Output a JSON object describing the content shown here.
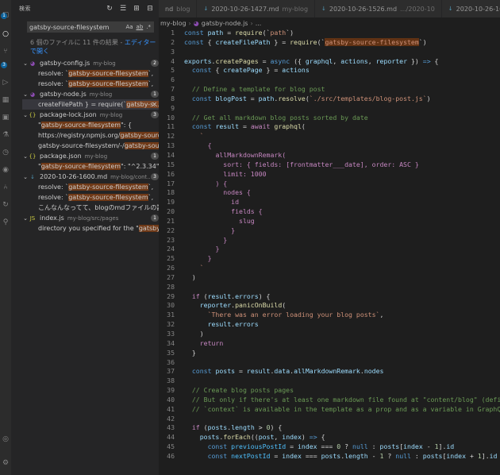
{
  "activity_bar": {
    "icons": [
      "files-icon",
      "search-icon",
      "source-control-icon",
      "debug-icon",
      "extensions-icon",
      "remote-icon",
      "test-icon",
      "timeline-icon",
      "github-icon",
      "account-icon",
      "settings-icon"
    ],
    "badges": {
      "files": "1",
      "scm": "3"
    }
  },
  "sidebar": {
    "title": "検索",
    "search_value": "gatsby-source-filesystem",
    "case_label": "Aa",
    "word_label": "ab",
    "regex_label": ".*",
    "summary_prefix": "6 個のファイルに 11 件の結果 - ",
    "summary_link": "エディターで開く",
    "results": [
      {
        "name": "gatsby-config.js",
        "path": "my-blog",
        "count": "2",
        "icon": "gatsby-icon",
        "matches": [
          {
            "pre": "resolve: `",
            "hit": "gatsby-source-filesystem",
            "post": "`,"
          },
          {
            "pre": "resolve: `",
            "hit": "gatsby-source-filesystem",
            "post": "`,"
          }
        ]
      },
      {
        "name": "gatsby-node.js",
        "path": "my-blog",
        "count": "1",
        "icon": "gatsby-icon",
        "matches": [
          {
            "pre": "createFilePath } = require(`",
            "hit": "gatsby-s...",
            "post": "",
            "selected": true
          }
        ]
      },
      {
        "name": "package-lock.json",
        "path": "my-blog",
        "count": "3",
        "icon": "json-icon",
        "matches": [
          {
            "pre": "\"",
            "hit": "gatsby-source-filesystem",
            "post": "\": {"
          },
          {
            "pre": "https://registry.npmjs.org/",
            "hit": "gatsby-source-fi...",
            "post": ""
          },
          {
            "pre": "gatsby-source-filesystem/-/",
            "hit": "gatsby-source...",
            "post": ""
          }
        ]
      },
      {
        "name": "package.json",
        "path": "my-blog",
        "count": "1",
        "icon": "json-icon",
        "matches": [
          {
            "pre": "\"",
            "hit": "gatsby-source-filesystem",
            "post": "\": \"^2.3.34\","
          }
        ]
      },
      {
        "name": "2020-10-26-1600.md",
        "path": "my-blog/cont...",
        "count": "3",
        "icon": "markdown-icon",
        "matches": [
          {
            "pre": "resolve: `",
            "hit": "gatsby-source-filesystem",
            "post": "`,"
          },
          {
            "pre": "resolve: `",
            "hit": "gatsby-source-filesystem",
            "post": "`,"
          },
          {
            "pre": "こんなんなってて、blogのmdファイルの読...",
            "hit": "",
            "post": ""
          }
        ]
      },
      {
        "name": "index.js",
        "path": "my-blog/src/pages",
        "count": "1",
        "icon": "js-icon",
        "matches": [
          {
            "pre": "directory you specified for the \"",
            "hit": "gatsby-so...",
            "post": ""
          }
        ]
      }
    ]
  },
  "tabs": [
    {
      "name": "nd",
      "path": "blog"
    },
    {
      "name": "2020-10-26-1427.md",
      "path": "my-blog"
    },
    {
      "name": "2020-10-26-1526.md",
      "path": ".../2020-10"
    },
    {
      "name": "2020-10-26-1600.md",
      "path": "my-blog"
    }
  ],
  "breadcrumb": {
    "folder": "my-blog",
    "file": "gatsby-node.js",
    "trail": "..."
  },
  "colors": {
    "accent": "#0e639c",
    "highlight": "#ea5c00",
    "editor_bg": "#1e1e1e",
    "sidebar_bg": "#252526"
  },
  "code": {
    "first_line": 1,
    "lines": [
      [
        [
          "kw",
          "const "
        ],
        [
          "var",
          "path"
        ],
        [
          "pun",
          " = "
        ],
        [
          "fn",
          "require"
        ],
        [
          "pun",
          "(`"
        ],
        [
          "st",
          "path"
        ],
        [
          "pun",
          "`)"
        ]
      ],
      [
        [
          "kw",
          "const "
        ],
        [
          "pun",
          "{ "
        ],
        [
          "var",
          "createFilePath"
        ],
        [
          "pun",
          " } = "
        ],
        [
          "fn",
          "require"
        ],
        [
          "pun",
          "(`"
        ],
        [
          "hl",
          "gatsby-source-filesystem"
        ],
        [
          "pun",
          "`)"
        ]
      ],
      [],
      [
        [
          "var",
          "exports"
        ],
        [
          "pun",
          "."
        ],
        [
          "fn",
          "createPages"
        ],
        [
          "pun",
          " = "
        ],
        [
          "kw",
          "async"
        ],
        [
          "pun",
          " ({ "
        ],
        [
          "var",
          "graphql"
        ],
        [
          "pun",
          ", "
        ],
        [
          "var",
          "actions"
        ],
        [
          "pun",
          ", "
        ],
        [
          "var",
          "reporter"
        ],
        [
          "pun",
          " }) "
        ],
        [
          "kw",
          "=>"
        ],
        [
          "pun",
          " {"
        ]
      ],
      [
        [
          "pun",
          "  "
        ],
        [
          "kw",
          "const "
        ],
        [
          "pun",
          "{ "
        ],
        [
          "var",
          "createPage"
        ],
        [
          "pun",
          " } = "
        ],
        [
          "var",
          "actions"
        ]
      ],
      [],
      [
        [
          "cm",
          "  // Define a template for blog post"
        ]
      ],
      [
        [
          "pun",
          "  "
        ],
        [
          "kw",
          "const "
        ],
        [
          "var",
          "blogPost"
        ],
        [
          "pun",
          " = "
        ],
        [
          "var",
          "path"
        ],
        [
          "pun",
          "."
        ],
        [
          "fn",
          "resolve"
        ],
        [
          "pun",
          "("
        ],
        [
          "st",
          "`./src/templates/blog-post.js`"
        ],
        [
          "pun",
          ")"
        ]
      ],
      [],
      [
        [
          "cm",
          "  // Get all markdown blog posts sorted by date"
        ]
      ],
      [
        [
          "pun",
          "  "
        ],
        [
          "kw",
          "const "
        ],
        [
          "var",
          "result"
        ],
        [
          "pun",
          " = "
        ],
        [
          "kc",
          "await "
        ],
        [
          "fn",
          "graphql"
        ],
        [
          "pun",
          "("
        ]
      ],
      [
        [
          "pun",
          "    "
        ],
        [
          "st",
          "`"
        ]
      ],
      [
        [
          "pun",
          "      "
        ],
        [
          "gq",
          "{"
        ]
      ],
      [
        [
          "pun",
          "        "
        ],
        [
          "gq",
          "allMarkdownRemark("
        ]
      ],
      [
        [
          "pun",
          "          "
        ],
        [
          "gq",
          "sort: { fields: [frontmatter___date], order: ASC }"
        ]
      ],
      [
        [
          "pun",
          "          "
        ],
        [
          "gq",
          "limit: 1000"
        ]
      ],
      [
        [
          "pun",
          "        "
        ],
        [
          "gq",
          ") {"
        ]
      ],
      [
        [
          "pun",
          "          "
        ],
        [
          "gq",
          "nodes {"
        ]
      ],
      [
        [
          "pun",
          "            "
        ],
        [
          "gq",
          "id"
        ]
      ],
      [
        [
          "pun",
          "            "
        ],
        [
          "gq",
          "fields {"
        ]
      ],
      [
        [
          "pun",
          "              "
        ],
        [
          "gq",
          "slug"
        ]
      ],
      [
        [
          "pun",
          "            "
        ],
        [
          "gq",
          "}"
        ]
      ],
      [
        [
          "pun",
          "          "
        ],
        [
          "gq",
          "}"
        ]
      ],
      [
        [
          "pun",
          "        "
        ],
        [
          "gq",
          "}"
        ]
      ],
      [
        [
          "pun",
          "      "
        ],
        [
          "gq",
          "}"
        ]
      ],
      [
        [
          "pun",
          "    "
        ],
        [
          "st",
          "`"
        ]
      ],
      [
        [
          "pun",
          "  )"
        ]
      ],
      [],
      [
        [
          "pun",
          "  "
        ],
        [
          "kc",
          "if "
        ],
        [
          "pun",
          "("
        ],
        [
          "var",
          "result"
        ],
        [
          "pun",
          "."
        ],
        [
          "var",
          "errors"
        ],
        [
          "pun",
          ") {"
        ]
      ],
      [
        [
          "pun",
          "    "
        ],
        [
          "var",
          "reporter"
        ],
        [
          "pun",
          "."
        ],
        [
          "fn",
          "panicOnBuild"
        ],
        [
          "pun",
          "("
        ]
      ],
      [
        [
          "pun",
          "      "
        ],
        [
          "st",
          "`There was an error loading your blog posts`"
        ],
        [
          "pun",
          ","
        ]
      ],
      [
        [
          "pun",
          "      "
        ],
        [
          "var",
          "result"
        ],
        [
          "pun",
          "."
        ],
        [
          "var",
          "errors"
        ]
      ],
      [
        [
          "pun",
          "    )"
        ]
      ],
      [
        [
          "pun",
          "    "
        ],
        [
          "kc",
          "return"
        ]
      ],
      [
        [
          "pun",
          "  }"
        ]
      ],
      [],
      [
        [
          "pun",
          "  "
        ],
        [
          "kw",
          "const "
        ],
        [
          "var",
          "posts"
        ],
        [
          "pun",
          " = "
        ],
        [
          "var",
          "result"
        ],
        [
          "pun",
          "."
        ],
        [
          "var",
          "data"
        ],
        [
          "pun",
          "."
        ],
        [
          "var",
          "allMarkdownRemark"
        ],
        [
          "pun",
          "."
        ],
        [
          "var",
          "nodes"
        ]
      ],
      [],
      [
        [
          "cm",
          "  // Create blog posts pages"
        ]
      ],
      [
        [
          "cm",
          "  // But only if there's at least one markdown file found at \"content/blog\" (defi"
        ]
      ],
      [
        [
          "cm",
          "  // `context` is available in the template as a prop and as a variable in GraphQ"
        ]
      ],
      [],
      [
        [
          "pun",
          "  "
        ],
        [
          "kc",
          "if "
        ],
        [
          "pun",
          "("
        ],
        [
          "var",
          "posts"
        ],
        [
          "pun",
          "."
        ],
        [
          "var",
          "length"
        ],
        [
          "pun",
          " > "
        ],
        [
          "num",
          "0"
        ],
        [
          "pun",
          ") {"
        ]
      ],
      [
        [
          "pun",
          "    "
        ],
        [
          "var",
          "posts"
        ],
        [
          "pun",
          "."
        ],
        [
          "fn",
          "forEach"
        ],
        [
          "pun",
          "(("
        ],
        [
          "var",
          "post"
        ],
        [
          "pun",
          ", "
        ],
        [
          "var",
          "index"
        ],
        [
          "pun",
          ") "
        ],
        [
          "kw",
          "=>"
        ],
        [
          "pun",
          " {"
        ]
      ],
      [
        [
          "pun",
          "      "
        ],
        [
          "kw",
          "const "
        ],
        [
          "cst",
          "previousPostId"
        ],
        [
          "pun",
          " = "
        ],
        [
          "var",
          "index"
        ],
        [
          "pun",
          " === "
        ],
        [
          "num",
          "0"
        ],
        [
          "pun",
          " ? "
        ],
        [
          "kw",
          "null"
        ],
        [
          "pun",
          " : "
        ],
        [
          "var",
          "posts"
        ],
        [
          "pun",
          "["
        ],
        [
          "var",
          "index"
        ],
        [
          "pun",
          " - "
        ],
        [
          "num",
          "1"
        ],
        [
          "pun",
          "]."
        ],
        [
          "var",
          "id"
        ]
      ],
      [
        [
          "pun",
          "      "
        ],
        [
          "kw",
          "const "
        ],
        [
          "cst",
          "nextPostId"
        ],
        [
          "pun",
          " = "
        ],
        [
          "var",
          "index"
        ],
        [
          "pun",
          " === "
        ],
        [
          "var",
          "posts"
        ],
        [
          "pun",
          "."
        ],
        [
          "var",
          "length"
        ],
        [
          "pun",
          " - "
        ],
        [
          "num",
          "1"
        ],
        [
          "pun",
          " ? "
        ],
        [
          "kw",
          "null"
        ],
        [
          "pun",
          " : "
        ],
        [
          "var",
          "posts"
        ],
        [
          "pun",
          "["
        ],
        [
          "var",
          "index"
        ],
        [
          "pun",
          " + "
        ],
        [
          "num",
          "1"
        ],
        [
          "pun",
          "]."
        ],
        [
          "var",
          "id"
        ]
      ]
    ]
  }
}
